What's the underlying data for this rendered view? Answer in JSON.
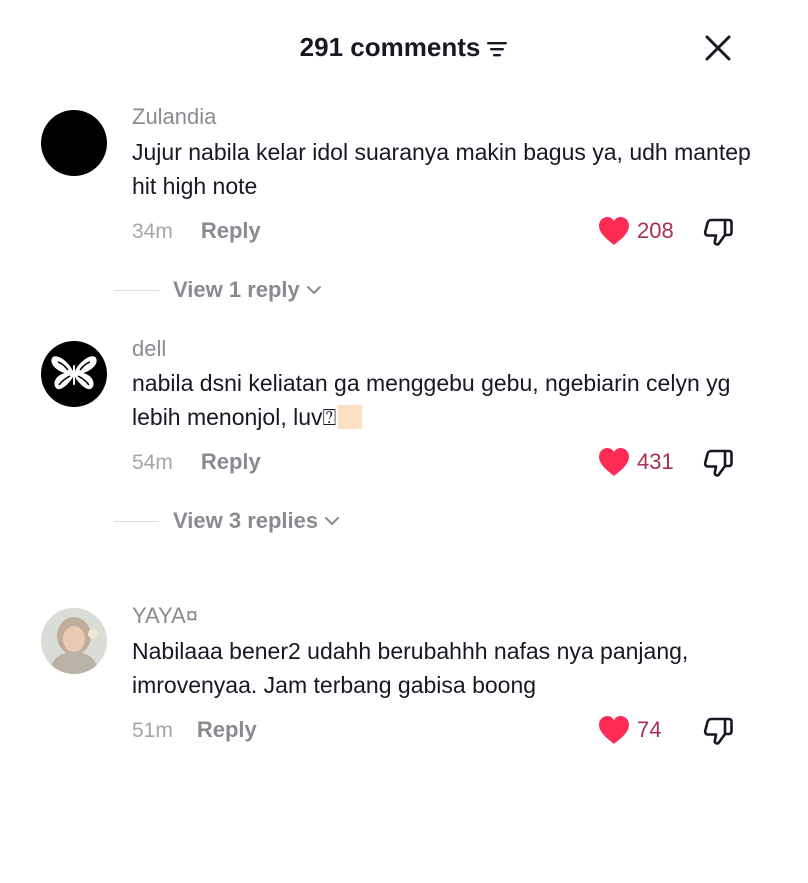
{
  "header": {
    "title": "291 comments",
    "sort_icon": "sort-lines-icon",
    "close_icon": "close-icon"
  },
  "colors": {
    "like_heart": "#fe2c55",
    "like_count": "#a8304f",
    "muted_text": "#8a8b91"
  },
  "comments": [
    {
      "username": "Zulandia",
      "text": "Jujur nabila kelar idol suaranya makin bagus ya, udh mantep hit high note",
      "time": "34m",
      "reply_label": "Reply",
      "likes": "208",
      "view_replies": "View 1 reply"
    },
    {
      "username": "dell",
      "text": "nabila dsni keliatan ga menggebu gebu, ngebiarin celyn yg lebih menonjol, luv",
      "emoji_fallback": "⍰",
      "time": "54m",
      "reply_label": "Reply",
      "likes": "431",
      "view_replies": "View 3 replies"
    },
    {
      "username": "YAYA¤",
      "text": "Nabilaaa bener2 udahh berubahhh nafas nya panjang, imrovenyaa. Jam terbang gabisa boong",
      "time": "51m",
      "reply_label": "Reply",
      "likes": "74"
    }
  ]
}
